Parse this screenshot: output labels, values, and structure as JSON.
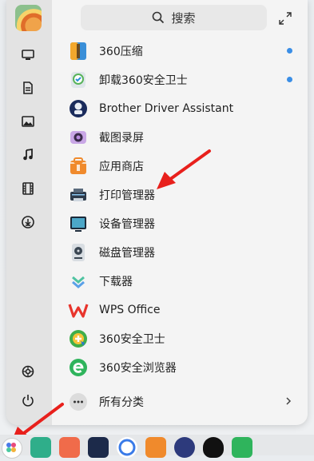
{
  "search": {
    "label": "搜索",
    "icon": "search-icon"
  },
  "sidebar": {
    "icons": [
      "monitor-icon",
      "document-icon",
      "image-icon",
      "music-note-icon",
      "film-icon",
      "download-icon",
      "settings-icon",
      "power-icon"
    ]
  },
  "apps": [
    {
      "label": "360压缩",
      "icon": "archive-icon",
      "new": true
    },
    {
      "label": "卸载360安全卫士",
      "icon": "uninstall-icon",
      "new": true
    },
    {
      "label": "Brother Driver Assistant",
      "icon": "brother-icon",
      "new": false
    },
    {
      "label": "截图录屏",
      "icon": "screenshot-icon",
      "new": false
    },
    {
      "label": "应用商店",
      "icon": "app-store-icon",
      "new": false
    },
    {
      "label": "打印管理器",
      "icon": "printer-icon",
      "new": false
    },
    {
      "label": "设备管理器",
      "icon": "device-manager-icon",
      "new": false
    },
    {
      "label": "磁盘管理器",
      "icon": "disk-manager-icon",
      "new": false
    },
    {
      "label": "下载器",
      "icon": "downloader-icon",
      "new": false
    },
    {
      "label": "WPS Office",
      "icon": "wps-icon",
      "new": false
    },
    {
      "label": "360安全卫士",
      "icon": "shield-360-icon",
      "new": false
    },
    {
      "label": "360安全浏览器",
      "icon": "browser-360-icon",
      "new": false
    }
  ],
  "all_categories": {
    "label": "所有分类",
    "icon": "more-icon",
    "chevron": "chevron-right-icon"
  },
  "colors": {
    "accent": "#3a8ee6",
    "arrow": "#e8201c"
  }
}
